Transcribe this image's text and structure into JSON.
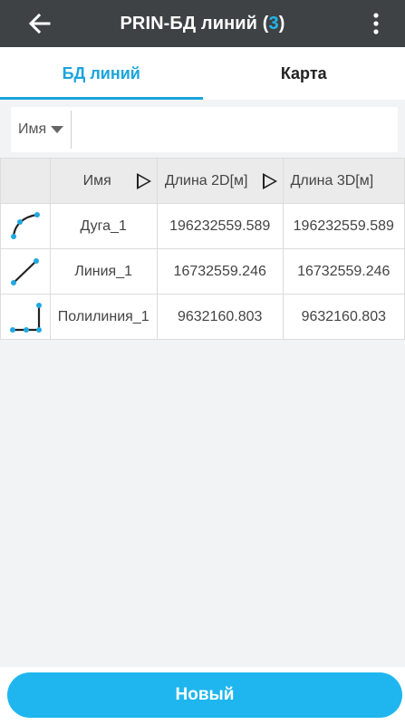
{
  "app_bar": {
    "title": "PRIN-БД линий (",
    "count": "3",
    "title_close": ")",
    "back_icon": "arrow-left-icon",
    "menu_icon": "more-vertical-icon"
  },
  "tabs": [
    {
      "label": "БД линий",
      "active": true
    },
    {
      "label": "Карта",
      "active": false
    }
  ],
  "filter": {
    "field_label": "Имя",
    "value": ""
  },
  "table": {
    "headers": [
      "Имя",
      "Длина 2D[м]",
      "Длина 3D[м]"
    ],
    "rows": [
      {
        "icon": "arc-line-icon",
        "name": "Дуга_1",
        "len2d": "196232559.589",
        "len3d": "196232559.589"
      },
      {
        "icon": "straight-line-icon",
        "name": "Линия_1",
        "len2d": "16732559.246",
        "len3d": "16732559.246"
      },
      {
        "icon": "polyline-icon",
        "name": "Полилиния_1",
        "len2d": "9632160.803",
        "len3d": "9632160.803"
      }
    ]
  },
  "actions": {
    "new_label": "Новый"
  },
  "colors": {
    "accent": "#1fb6ef",
    "app_bar": "#3e4245"
  }
}
